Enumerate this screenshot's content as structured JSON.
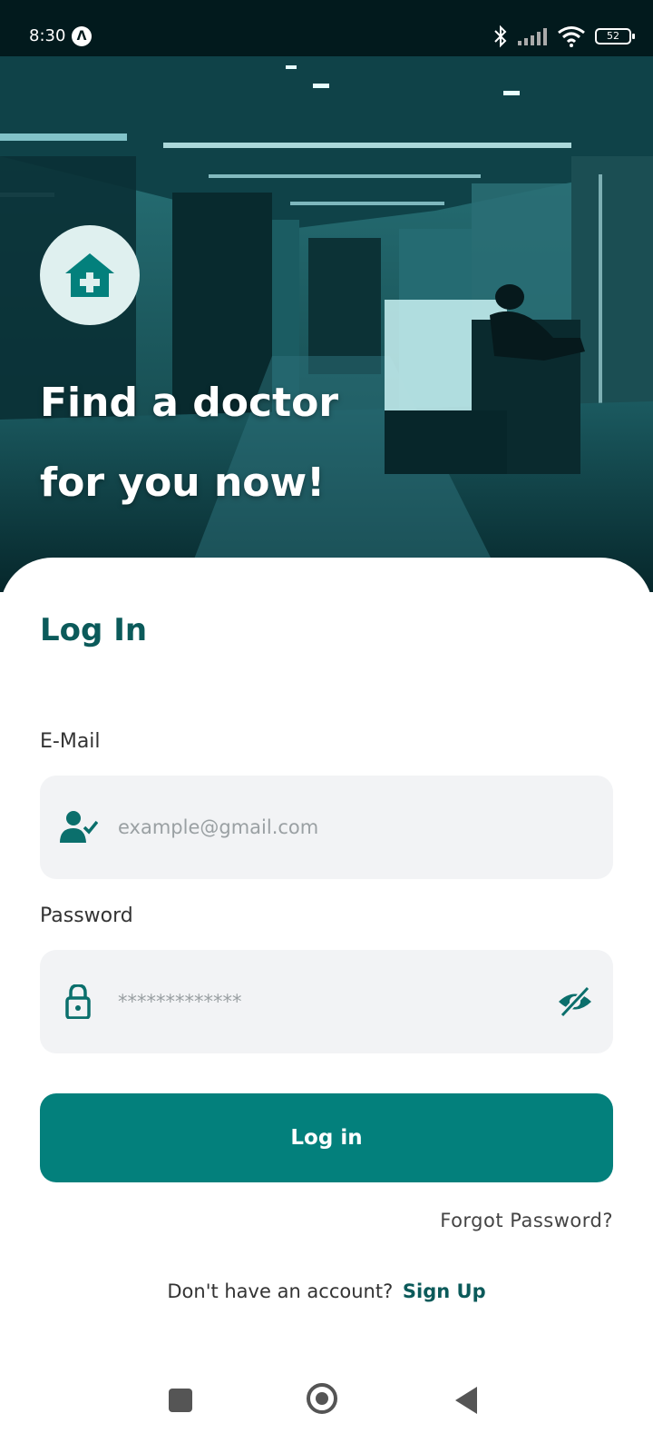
{
  "status_bar": {
    "time": "8:30",
    "app_icon_glyph": "Λ",
    "battery_level": "52",
    "icons": [
      "bluetooth-icon",
      "signal-icon",
      "wifi-icon",
      "battery-icon"
    ]
  },
  "hero": {
    "logo_icon": "hospital-house-plus-icon",
    "title_line1": "Find a doctor",
    "title_line2": "for you now!"
  },
  "login": {
    "heading": "Log In",
    "email": {
      "label": "E-Mail",
      "placeholder": "example@gmail.com",
      "value": "",
      "icon": "user-check-icon"
    },
    "password": {
      "label": "Password",
      "placeholder": "*************",
      "value": "",
      "icon": "lock-icon",
      "toggle_icon": "eye-off-icon"
    },
    "submit_label": "Log in",
    "forgot_label": "Forgot Password?",
    "signup_prompt": "Don't have an account?",
    "signup_label": "Sign Up"
  },
  "nav_bar": {
    "buttons": [
      "recent-apps",
      "home",
      "back"
    ]
  },
  "colors": {
    "primary": "#03807c",
    "heading": "#0b5a5a",
    "input_bg": "#f2f3f5",
    "status_bar_bg": "#021a1d"
  }
}
